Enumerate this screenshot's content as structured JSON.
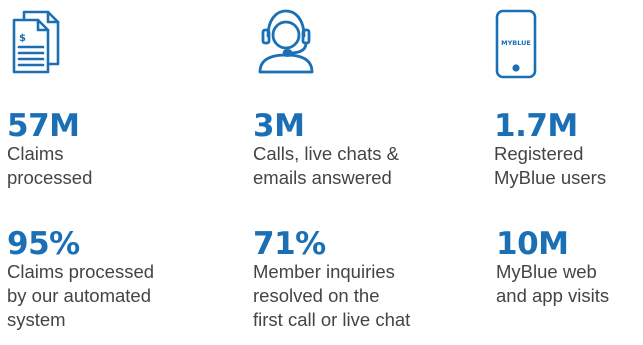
{
  "colors": {
    "accent": "#1a6fb5",
    "text": "#444444"
  },
  "icons": {
    "claims": "documents-icon",
    "support": "headset-agent-icon",
    "mobile": "smartphone-icon",
    "mobile_screen_text": "MYBLUE"
  },
  "stats": [
    {
      "value": "57M",
      "label": "Claims\nprocessed"
    },
    {
      "value": "3M",
      "label": "Calls, live chats &\nemails answered"
    },
    {
      "value": "1.7M",
      "label": "Registered\nMyBlue users"
    },
    {
      "value": "95%",
      "label": "Claims processed\nby our automated\nsystem"
    },
    {
      "value": "71%",
      "label": "Member inquiries\nresolved on the\nfirst call or live chat"
    },
    {
      "value": "10M",
      "label": "MyBlue web\nand app visits"
    }
  ]
}
